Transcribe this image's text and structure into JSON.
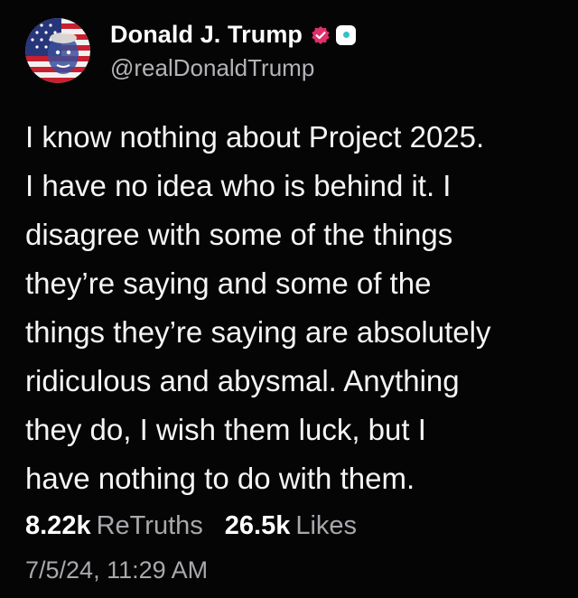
{
  "post": {
    "author": {
      "display_name": "Donald J. Trump",
      "handle": "@realDonaldTrump",
      "badge_icon": "verified-check-icon",
      "badge_color": "#e1306c"
    },
    "body_lines": [
      "I know nothing about Project 2025.",
      "I have no idea who is behind it. I",
      "disagree with some of the things",
      "they’re saying and some of the",
      "things they’re saying are absolutely",
      "ridiculous and abysmal. Anything",
      "they do, I wish them luck, but I",
      "have nothing to do with them."
    ],
    "stats": {
      "retruths_count": "8.22k",
      "retruths_label": "ReTruths",
      "likes_count": "26.5k",
      "likes_label": "Likes"
    },
    "timestamp": "7/5/24, 11:29 AM"
  }
}
